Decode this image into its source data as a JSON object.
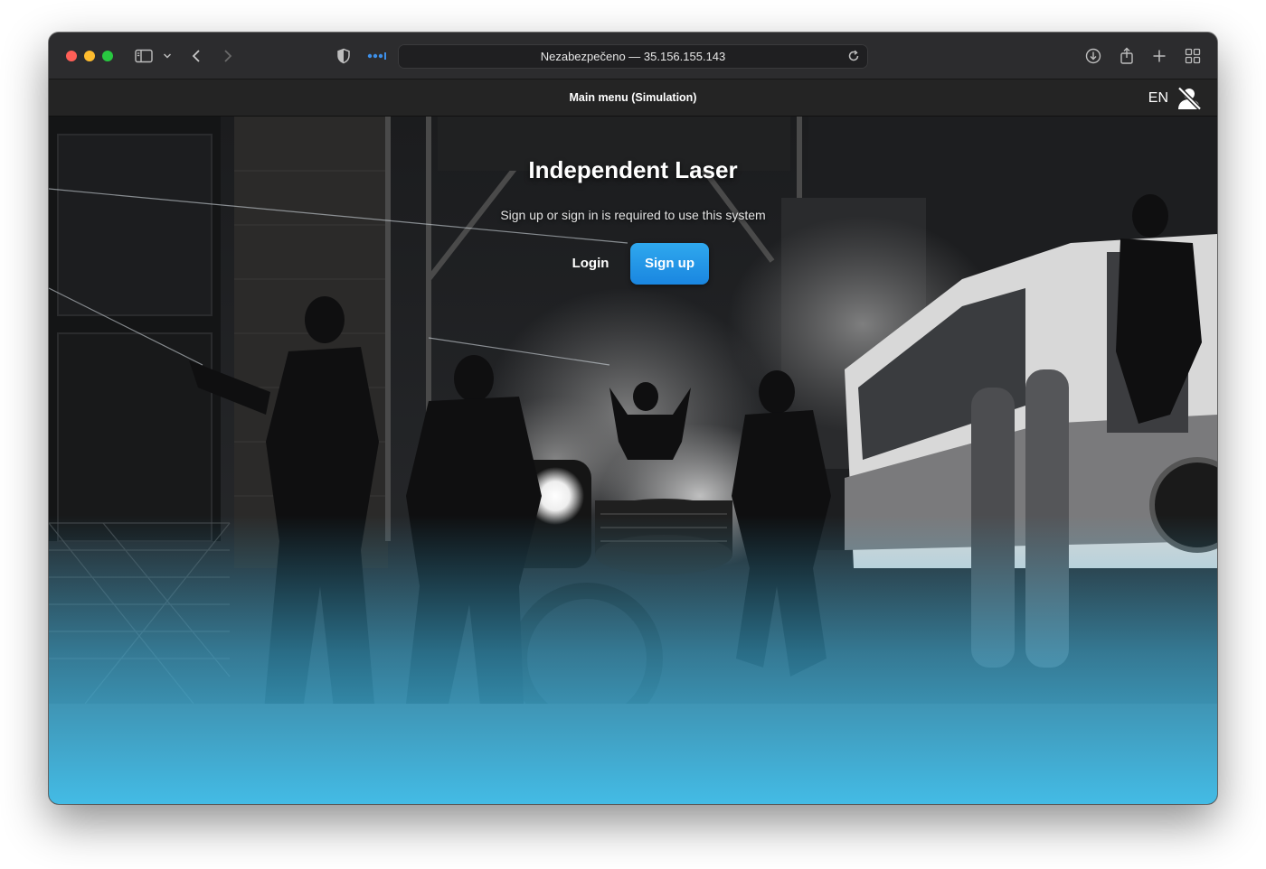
{
  "browser": {
    "address": "Nezabezpečeno — 35.156.155.143",
    "icons": [
      "sidebar-icon",
      "chevron-down-icon",
      "back-icon",
      "forward-icon",
      "shield-icon",
      "extension-icon",
      "reload-icon",
      "download-icon",
      "share-icon",
      "new-tab-icon",
      "tab-overview-icon"
    ]
  },
  "nav": {
    "title": "Main menu (Simulation)",
    "language": "EN",
    "user_icon": "user-off-icon"
  },
  "hero": {
    "title": "Independent Laser",
    "subtitle": "Sign up or sign in is required to use this system",
    "login_label": "Login",
    "signup_label": "Sign up",
    "accent_color": "#1f8fe6",
    "glow_color": "#44c2ee"
  }
}
